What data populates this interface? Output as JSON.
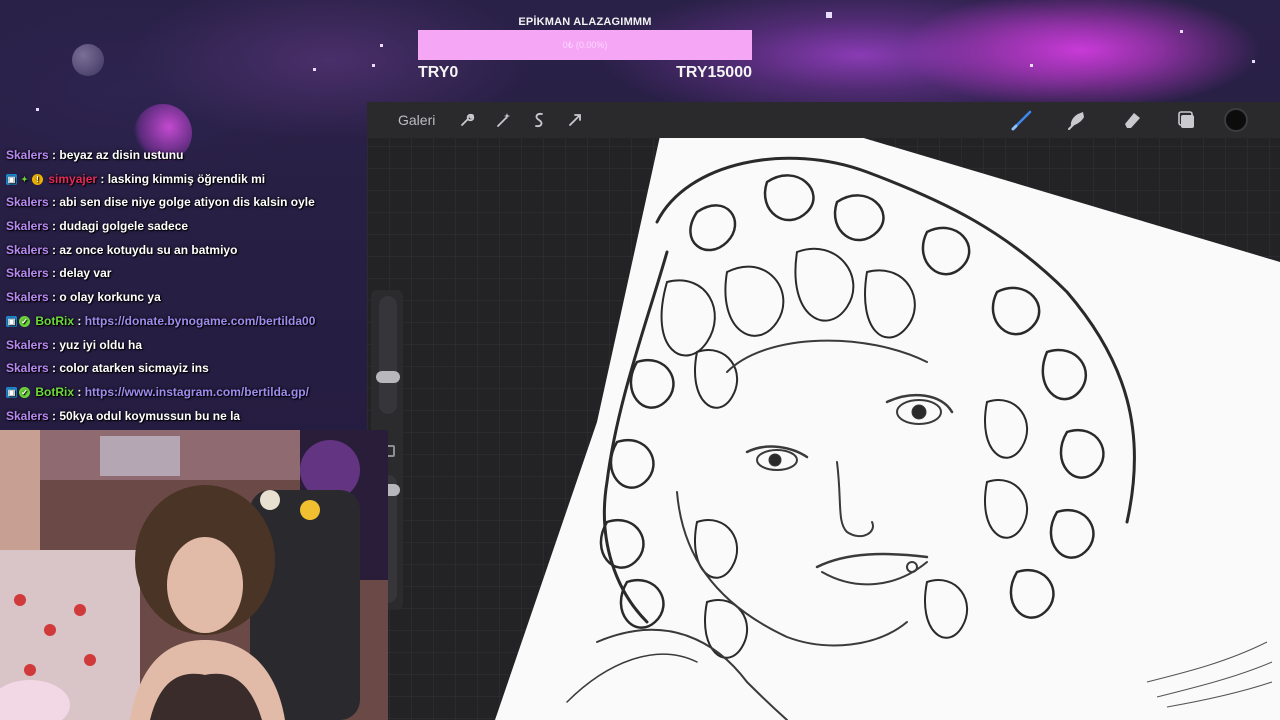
{
  "goal": {
    "title": "EPİKMAN ALAZAGIMMM",
    "progress_text": "0₺ (0.00%)",
    "progress_fraction": 0.0,
    "min_label": "TRY0",
    "max_label": "TRY15000"
  },
  "toolbar": {
    "gallery_label": "Galeri",
    "left_icons": [
      "wrench-icon",
      "magic-wand-icon",
      "selection-icon",
      "transform-icon"
    ],
    "right_icons": [
      "brush-icon",
      "smudge-icon",
      "eraser-icon",
      "layers-icon",
      "color-icon"
    ],
    "active_color": "#0c0c0c"
  },
  "chat": {
    "messages": [
      {
        "user": "Skalers",
        "sep": " : ",
        "text": "beyaz az disin ustunu",
        "badges": []
      },
      {
        "user": "simyajer",
        "sep": " : ",
        "text": "lasking kimmiş öğrendik mi",
        "badges": [
          "prime",
          "gift",
          "bits"
        ]
      },
      {
        "user": "Skalers",
        "sep": " : ",
        "text": "abi sen dise niye golge atiyon dis kalsin oyle",
        "badges": []
      },
      {
        "user": "Skalers",
        "sep": " : ",
        "text": "dudagi golgele sadece",
        "badges": []
      },
      {
        "user": "Skalers",
        "sep": " : ",
        "text": "az once kotuydu su an batmiyo",
        "badges": []
      },
      {
        "user": "Skalers",
        "sep": " : ",
        "text": "delay var",
        "badges": []
      },
      {
        "user": "Skalers",
        "sep": " : ",
        "text": "o olay korkunc ya",
        "badges": []
      },
      {
        "user": "BotRix",
        "sep": " : ",
        "text": "https://donate.bynogame.com/bertilda00",
        "badges": [
          "prime",
          "verified"
        ]
      },
      {
        "user": "Skalers",
        "sep": " : ",
        "text": "yuz iyi oldu ha",
        "badges": []
      },
      {
        "user": "Skalers",
        "sep": " : ",
        "text": "color atarken sicmayiz ins",
        "badges": []
      },
      {
        "user": "BotRix",
        "sep": " : ",
        "text": "https://www.instagram.com/bertilda.gp/",
        "badges": [
          "prime",
          "verified"
        ]
      },
      {
        "user": "Skalers",
        "sep": " : ",
        "text": "50kya odul koymussun bu ne la",
        "badges": []
      }
    ]
  },
  "colors": {
    "skalers": "#b889f4",
    "simyajer": "#e52a5a",
    "botrix": "#6dd83a",
    "link": "#9e8cf0",
    "goal_bar": "#f5a6f5"
  }
}
